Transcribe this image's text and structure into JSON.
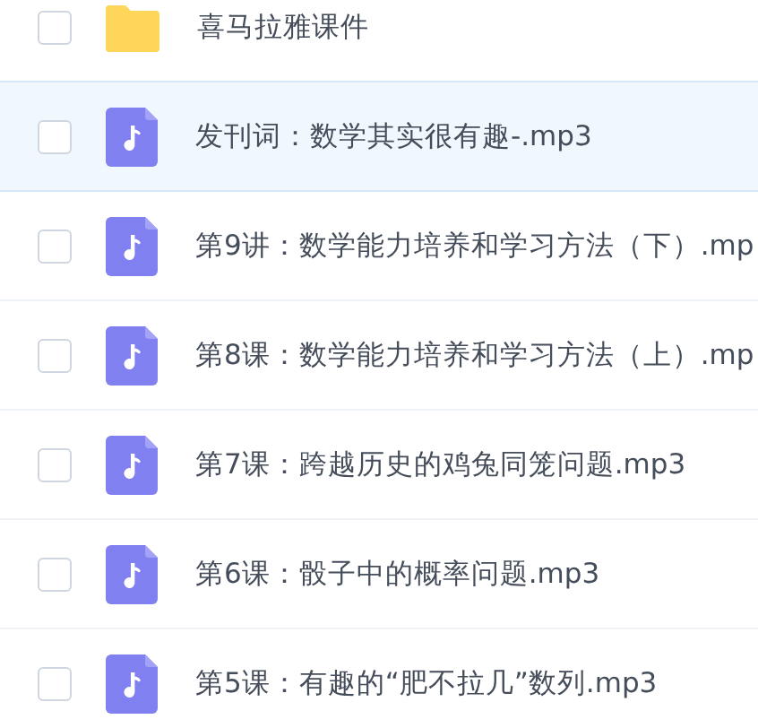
{
  "files": [
    {
      "kind": "folder",
      "name": "喜马拉雅课件",
      "selected": false,
      "checked": false
    },
    {
      "kind": "audio",
      "name": "发刊词：数学其实很有趣-.mp3",
      "selected": true,
      "checked": false
    },
    {
      "kind": "audio",
      "name": "第9讲：数学能力培养和学习方法（下）.mp",
      "selected": false,
      "checked": false
    },
    {
      "kind": "audio",
      "name": "第8课：数学能力培养和学习方法（上）.mp",
      "selected": false,
      "checked": false
    },
    {
      "kind": "audio",
      "name": "第7课：跨越历史的鸡兔同笼问题.mp3",
      "selected": false,
      "checked": false
    },
    {
      "kind": "audio",
      "name": "第6课：骰子中的概率问题.mp3",
      "selected": false,
      "checked": false
    },
    {
      "kind": "audio",
      "name": "第5课：有趣的“肥不拉几”数列.mp3",
      "selected": false,
      "checked": false
    }
  ]
}
